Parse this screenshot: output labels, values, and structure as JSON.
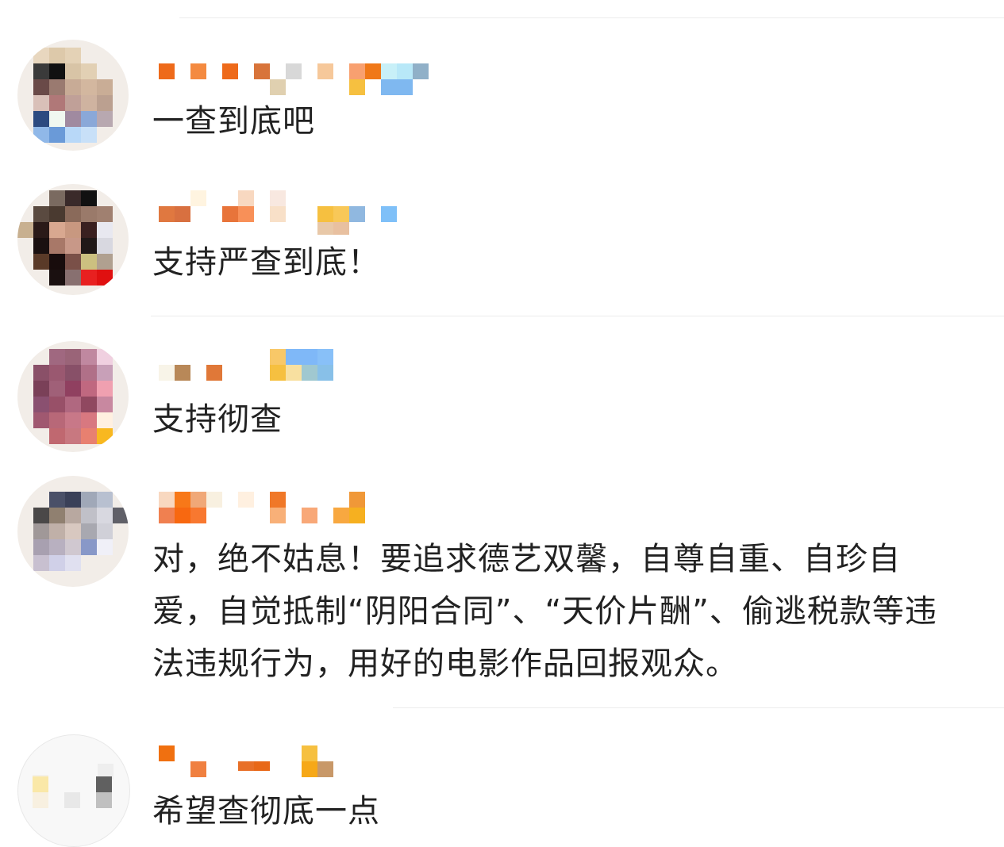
{
  "comments": [
    {
      "text": "一查到底吧"
    },
    {
      "text": "支持严查到底！"
    },
    {
      "text": "支持彻查"
    },
    {
      "text": "对，绝不姑息！要追求德艺双馨，自尊自重、自珍自爱，自觉抵制“阴阳合同”、“天价片酬”、偷逃税款等违法违规行为，用好的电影作品回报观众。"
    },
    {
      "text": "希望查彻底一点"
    }
  ],
  "colors": {
    "text": "#222222",
    "divider": "#ececec",
    "username_orange": "#f07a2a",
    "username_blue": "#7fb8f0",
    "username_yellow": "#f6c040"
  }
}
